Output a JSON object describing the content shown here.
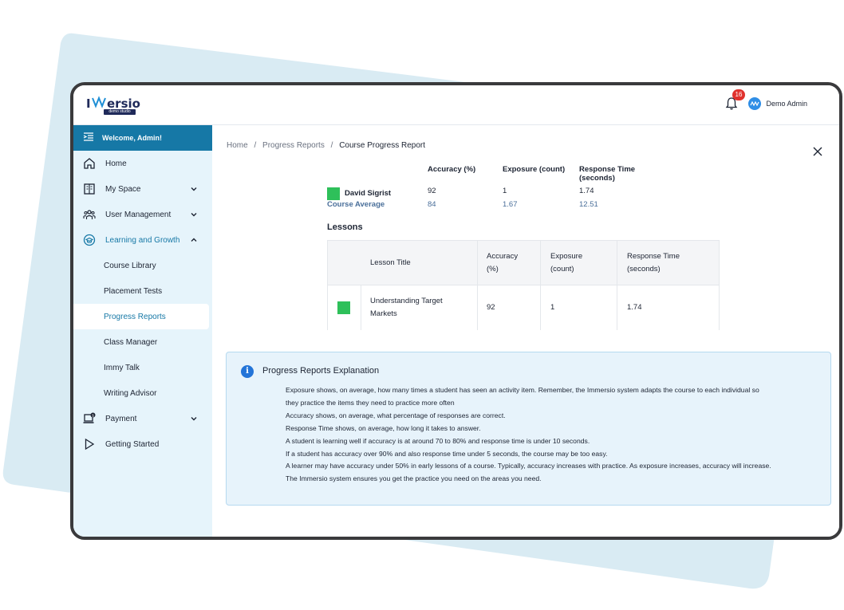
{
  "app": {
    "logo_text": "IMMERSIO",
    "logo_subtext": "demo studio",
    "notification_count": "16",
    "user_name": "Demo Admin"
  },
  "sidebar": {
    "welcome": "Welcome, Admin!",
    "items": [
      {
        "label": "Home",
        "icon": "home-icon"
      },
      {
        "label": "My Space",
        "icon": "book-icon"
      },
      {
        "label": "User Management",
        "icon": "users-icon"
      },
      {
        "label": "Learning and Growth",
        "icon": "graduation-icon"
      }
    ],
    "sub_items": [
      {
        "label": "Course Library"
      },
      {
        "label": "Placement Tests"
      },
      {
        "label": "Progress Reports"
      },
      {
        "label": "Class Manager"
      },
      {
        "label": "Immy Talk"
      },
      {
        "label": "Writing Advisor"
      }
    ],
    "payment": {
      "label": "Payment",
      "icon": "payment-icon"
    },
    "getting_started": {
      "label": "Getting Started",
      "icon": "play-icon"
    }
  },
  "breadcrumb": {
    "home": "Home",
    "sep1": "/",
    "progress": "Progress Reports",
    "sep2": "/",
    "current": "Course Progress Report"
  },
  "summary": {
    "headers": {
      "accuracy": "Accuracy (%)",
      "exposure": "Exposure (count)",
      "response_line1": "Response Time",
      "response_line2": "(seconds)"
    },
    "student": {
      "name": "David Sigrist",
      "accuracy": "92",
      "exposure": "1",
      "response": "1.74"
    },
    "average": {
      "name": "Course Average",
      "accuracy": "84",
      "exposure": "1.67",
      "response": "12.51"
    }
  },
  "lessons": {
    "title": "Lessons",
    "headers": {
      "title": "Lesson Title",
      "accuracy_l1": "Accuracy",
      "accuracy_l2": "(%)",
      "exposure_l1": "Exposure",
      "exposure_l2": "(count)",
      "response_l1": "Response Time",
      "response_l2": "(seconds)"
    },
    "rows": [
      {
        "title_l1": "Understanding Target",
        "title_l2": "Markets",
        "accuracy": "92",
        "exposure": "1",
        "response": "1.74",
        "status_color": "#2ec05a"
      }
    ]
  },
  "explanation": {
    "title": "Progress Reports Explanation",
    "lines": [
      "Exposure shows, on average, how many times a student has seen an activity item. Remember, the Immersio system adapts the course to each individual so",
      "they practice the items they need to practice more often",
      "Accuracy shows, on average, what percentage of responses are correct.",
      "Response Time shows, on average, how long it takes to answer.",
      "A student is learning well if accuracy is at around 70 to 80% and response time is under 10 seconds.",
      "If a student has accuracy over 90% and also response time under 5 seconds, the course may be too easy.",
      "A learner may have accuracy under 50% in early lessons of a course. Typically, accuracy increases with practice. As exposure increases, accuracy will increase.",
      "The Immersio system ensures you get the practice you need on the areas you need."
    ]
  },
  "colors": {
    "primary": "#1678a6",
    "sidebar_bg": "#e6f4fb",
    "status_green": "#2ec05a",
    "badge_red": "#e0322d",
    "info_blue": "#2374d8"
  }
}
